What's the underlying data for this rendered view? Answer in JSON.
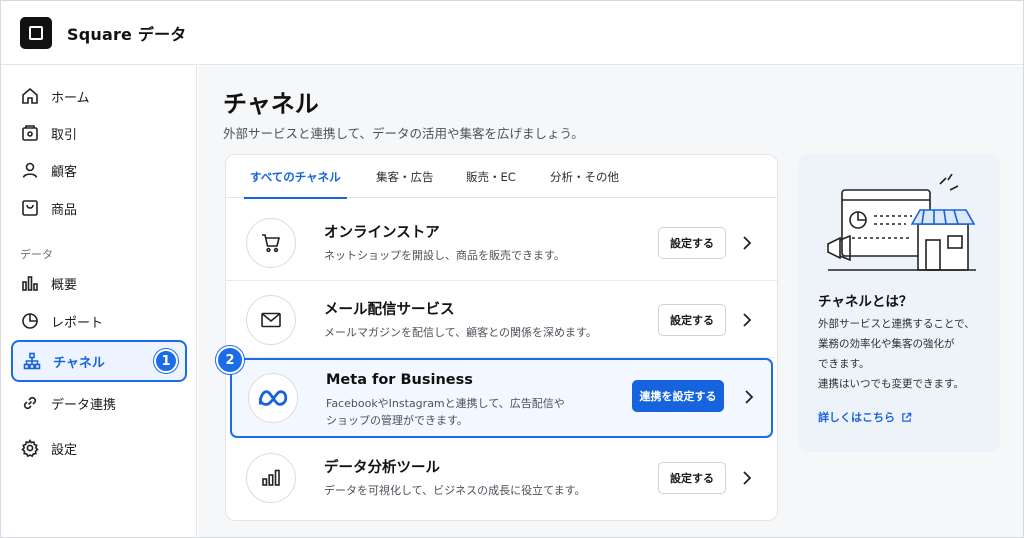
{
  "header": {
    "app_title": "Square データ"
  },
  "sidebar": {
    "items": [
      {
        "label": "ホーム",
        "icon": "home-icon"
      },
      {
        "label": "取引",
        "icon": "receipt-icon"
      },
      {
        "label": "顧客",
        "icon": "person-icon"
      },
      {
        "label": "商品",
        "icon": "tag-icon"
      },
      {
        "label": "概要",
        "icon": "bar-chart-icon"
      },
      {
        "label": "レポート",
        "icon": "pie-chart-icon"
      },
      {
        "label": "チャネル",
        "icon": "hierarchy-icon"
      },
      {
        "label": "データ連携",
        "icon": "link-icon"
      },
      {
        "label": "設定",
        "icon": "gear-icon"
      }
    ],
    "section_label": "データ",
    "active_badge": "1"
  },
  "main": {
    "title": "チャネル",
    "subtitle": "外部サービスと連携して、データの活用や集客を広げましょう。",
    "tabs": [
      {
        "label": "すべてのチャネル",
        "active": true
      },
      {
        "label": "集客・広告"
      },
      {
        "label": "販売・EC"
      },
      {
        "label": "分析・その他"
      }
    ],
    "rows": [
      {
        "title": "オンラインストア",
        "desc": "ネットショップを開設し、商品を販売できます。",
        "button": "設定する",
        "icon": "cart-icon"
      },
      {
        "title": "メール配信サービス",
        "desc": "メールマガジンを配信して、顧客との関係を深めます。",
        "button": "設定する",
        "icon": "mail-icon"
      },
      {
        "title": "Meta for Business",
        "desc_line1": "FacebookやInstagramと連携して、広告配信や",
        "desc_line2": "ショップの管理ができます。",
        "button": "連携を設定する",
        "icon": "meta-icon",
        "badge": "2"
      },
      {
        "title": "データ分析ツール",
        "desc": "データを可視化して、ビジネスの成長に役立てます。",
        "button": "設定する",
        "icon": "analytics-icon"
      }
    ]
  },
  "info": {
    "title": "チャネルとは？",
    "lines": [
      "外部サービスと連携することで、",
      "業務の効率化や集客の強化が",
      "できます。",
      "連携はいつでも変更できます。"
    ],
    "link": "詳しくはこちら"
  },
  "colors": {
    "accent": "#1664dd",
    "highlight_border": "#1a6ce8"
  }
}
